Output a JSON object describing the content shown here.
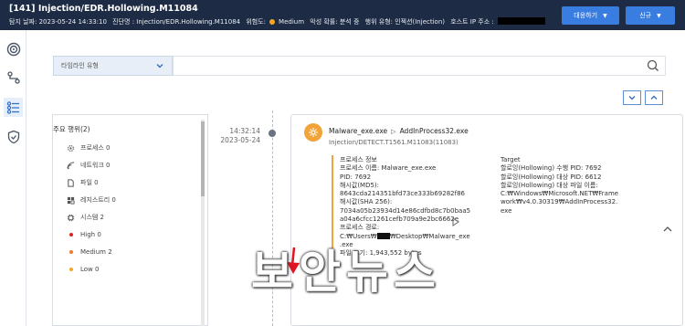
{
  "header": {
    "title": "[141] Injection/EDR.Hollowing.M11084",
    "detect_date": "탐지 날짜: 2023-05-24 14:33:10",
    "diag_name": "진단명 : Injection/EDR.Hollowing.M11084",
    "risk_label": "위험도:",
    "risk_value": "Medium",
    "prob": "악성 확률: 분석 중",
    "behavior": "행위 유형: 인젝션(Injection)",
    "host_ip": "호스트 IP 주소 :",
    "respond_btn": "대응하기",
    "new_btn": "신규"
  },
  "sidebar": {
    "icons": [
      "logo-icon",
      "flow-icon",
      "timeline-icon",
      "shield-icon"
    ]
  },
  "filter": {
    "timeline_type": "타임라인 유형"
  },
  "left_panel": {
    "header": "주요 행위(2)",
    "items": [
      {
        "label": "프로세스 0",
        "icon": "gear-icon"
      },
      {
        "label": "네트워크 0",
        "icon": "network-icon"
      },
      {
        "label": "파일 0",
        "icon": "file-icon"
      },
      {
        "label": "레지스트리 0",
        "icon": "registry-icon"
      },
      {
        "label": "시스템 2",
        "icon": "system-icon"
      },
      {
        "label": "High 0",
        "color": "#e02020"
      },
      {
        "label": "Medium 2",
        "color": "#f07b2a"
      },
      {
        "label": "Low 0",
        "color": "#f5a623"
      }
    ]
  },
  "event": {
    "time": "14:32:14",
    "date": "2023-05-24",
    "src_proc": "Malware_exe.exe",
    "dst_proc": "AddInProcess32.exe",
    "detect": "Injection/DETECT.T1561.M11083(11083)",
    "proc_info": {
      "header": "프로세스 정보",
      "name": "프로세스 이름: Malware_exe.exe",
      "pid": "PID: 7692",
      "md5_label": "해시값(MD5):",
      "md5": "8643cda214351bfd73ce333b69282f86",
      "sha_label": "해시값(SHA 256):",
      "sha1": "7034a05b23934d14e86cdfbd8c7b0baa5",
      "sha2": "a04a6cfcc1261cefb709a9e2bc6662e",
      "path_label": "프로세스 경로:",
      "path_a": "C:₩Users₩",
      "path_b": "₩Desktop₩Malware_exe",
      "path_c": ".exe",
      "size": "파일 크기: 1,943,552 bytes"
    },
    "target": {
      "header": "Target",
      "pid": "할로잉(Hollowing) 수행 PID: 7692",
      "target_pid": "할로잉(Hollowing) 대상 PID: 6612",
      "file_label": "할로잉(Hollowing) 대상 파일 이름:",
      "file1": "C:₩Windows₩Microsoft.NET₩Frame",
      "file2": "work₩v4.0.30319₩AddInProcess32.",
      "file3": "exe"
    }
  },
  "watermark": "보안뉴스"
}
